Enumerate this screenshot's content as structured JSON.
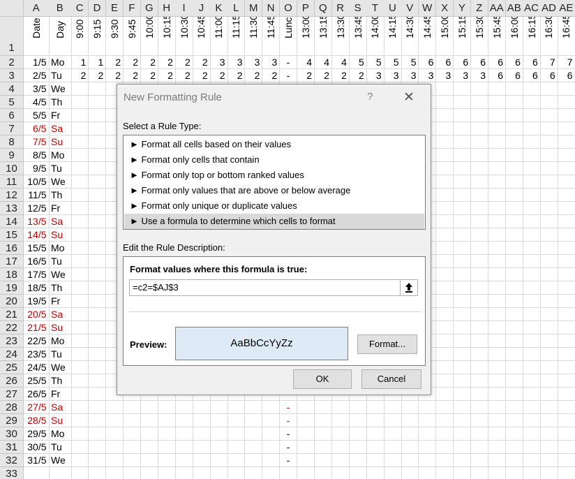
{
  "columns": [
    "A",
    "B",
    "C",
    "D",
    "E",
    "F",
    "G",
    "H",
    "I",
    "J",
    "K",
    "L",
    "M",
    "N",
    "O",
    "P",
    "Q",
    "R",
    "S",
    "T",
    "U",
    "V",
    "W",
    "X",
    "Y",
    "Z",
    "AA",
    "AB",
    "AC",
    "AD",
    "AE"
  ],
  "row_numbers": [
    "1",
    "2",
    "3",
    "4",
    "5",
    "6",
    "7",
    "8",
    "9",
    "10",
    "11",
    "12",
    "13",
    "14",
    "15",
    "16",
    "17",
    "18",
    "19",
    "20",
    "21",
    "22",
    "23",
    "24",
    "25",
    "26",
    "27",
    "28",
    "29",
    "30",
    "31",
    "32",
    "33"
  ],
  "header_row": [
    "Date",
    "Day",
    "9:00",
    "9:15",
    "9:30",
    "9:45",
    "10:00",
    "10:15",
    "10:30",
    "10:45",
    "11:00",
    "11:15",
    "11:30",
    "11:45",
    "Lunch",
    "13:00",
    "13:15",
    "13:30",
    "13:45",
    "14:00",
    "14:15",
    "14:30",
    "14:45",
    "15:00",
    "15:15",
    "15:30",
    "15:45",
    "16:00",
    "16:15",
    "16:30",
    "16:45"
  ],
  "row2": [
    "1/5",
    "Mo",
    "1",
    "1",
    "2",
    "2",
    "2",
    "2",
    "2",
    "2",
    "3",
    "3",
    "3",
    "3",
    "-",
    "4",
    "4",
    "4",
    "5",
    "5",
    "5",
    "5",
    "6",
    "6",
    "6",
    "6",
    "6",
    "6",
    "6",
    "7",
    "7"
  ],
  "row3": [
    "2/5",
    "Tu",
    "2",
    "2",
    "2",
    "2",
    "2",
    "2",
    "2",
    "2",
    "2",
    "2",
    "2",
    "2",
    "-",
    "2",
    "2",
    "2",
    "2",
    "3",
    "3",
    "3",
    "3",
    "3",
    "3",
    "3",
    "6",
    "6",
    "6",
    "6",
    "6"
  ],
  "dates": [
    {
      "date": "3/5",
      "day": "We",
      "weekend": false
    },
    {
      "date": "4/5",
      "day": "Th",
      "weekend": false
    },
    {
      "date": "5/5",
      "day": "Fr",
      "weekend": false
    },
    {
      "date": "6/5",
      "day": "Sa",
      "weekend": true
    },
    {
      "date": "7/5",
      "day": "Su",
      "weekend": true
    },
    {
      "date": "8/5",
      "day": "Mo",
      "weekend": false
    },
    {
      "date": "9/5",
      "day": "Tu",
      "weekend": false
    },
    {
      "date": "10/5",
      "day": "We",
      "weekend": false
    },
    {
      "date": "11/5",
      "day": "Th",
      "weekend": false
    },
    {
      "date": "12/5",
      "day": "Fr",
      "weekend": false
    },
    {
      "date": "13/5",
      "day": "Sa",
      "weekend": true
    },
    {
      "date": "14/5",
      "day": "Su",
      "weekend": true
    },
    {
      "date": "15/5",
      "day": "Mo",
      "weekend": false
    },
    {
      "date": "16/5",
      "day": "Tu",
      "weekend": false
    },
    {
      "date": "17/5",
      "day": "We",
      "weekend": false
    },
    {
      "date": "18/5",
      "day": "Th",
      "weekend": false
    },
    {
      "date": "19/5",
      "day": "Fr",
      "weekend": false
    },
    {
      "date": "20/5",
      "day": "Sa",
      "weekend": true
    },
    {
      "date": "21/5",
      "day": "Su",
      "weekend": true
    },
    {
      "date": "22/5",
      "day": "Mo",
      "weekend": false
    },
    {
      "date": "23/5",
      "day": "Tu",
      "weekend": false
    },
    {
      "date": "24/5",
      "day": "We",
      "weekend": false
    },
    {
      "date": "25/5",
      "day": "Th",
      "weekend": false
    },
    {
      "date": "26/5",
      "day": "Fr",
      "weekend": false
    },
    {
      "date": "27/5",
      "day": "Sa",
      "weekend": true
    },
    {
      "date": "28/5",
      "day": "Su",
      "weekend": true
    },
    {
      "date": "29/5",
      "day": "Mo",
      "weekend": false
    },
    {
      "date": "30/5",
      "day": "Tu",
      "weekend": false
    },
    {
      "date": "31/5",
      "day": "We",
      "weekend": false
    }
  ],
  "lunch_dash": "-",
  "lunch_dash_rows": [
    28,
    29,
    30,
    31,
    32
  ],
  "weekend_color": "#c00000",
  "dialog": {
    "title": "New Formatting Rule",
    "help": "?",
    "close": "✕",
    "select_rule_label": "Select a Rule Type:",
    "rule_types": [
      "► Format all cells based on their values",
      "► Format only cells that contain",
      "► Format only top or bottom ranked values",
      "► Format only values that are above or below average",
      "► Format only unique or duplicate values",
      "► Use a formula to determine which cells to format"
    ],
    "selected_rule_index": 5,
    "edit_desc_label": "Edit the Rule Description:",
    "formula_label": "Format values where this formula is true:",
    "formula_value": "=c2=$AJ$3",
    "preview_label": "Preview:",
    "preview_sample": "AaBbCcYyZz",
    "preview_fill": "#deebf7",
    "format_button": "Format...",
    "ok_button": "OK",
    "cancel_button": "Cancel"
  }
}
